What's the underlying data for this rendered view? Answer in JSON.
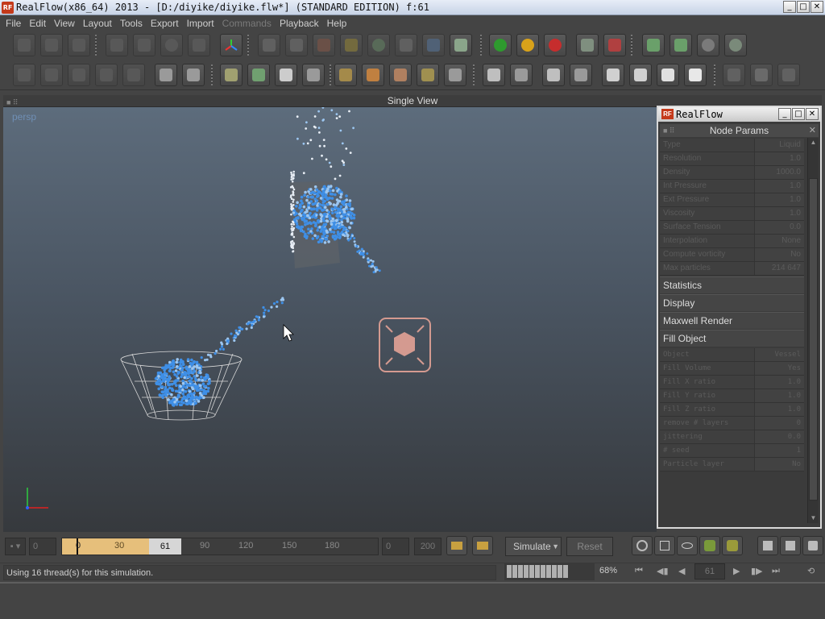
{
  "window": {
    "title": "RealFlow(x86_64) 2013 - [D:/diyike/diyike.flw*] (STANDARD EDITION) f:61",
    "app_icon": "RF",
    "minimize": "_",
    "maximize": "□",
    "close": "✕"
  },
  "menu": [
    "File",
    "Edit",
    "View",
    "Layout",
    "Tools",
    "Export",
    "Import",
    "Commands",
    "Playback",
    "Help"
  ],
  "viewport": {
    "header": "Single View",
    "camera": "persp"
  },
  "panel": {
    "window_title": "RealFlow",
    "header": "Node Params",
    "params": [
      {
        "label": "Type",
        "value": "Liquid"
      },
      {
        "label": "Resolution",
        "value": "1.0"
      },
      {
        "label": "Density",
        "value": "1000.0"
      },
      {
        "label": "Int Pressure",
        "value": "1.0"
      },
      {
        "label": "Ext Pressure",
        "value": "1.0"
      },
      {
        "label": "Viscosity",
        "value": "1.0"
      },
      {
        "label": "Surface Tension",
        "value": "0.0"
      },
      {
        "label": "Interpolation",
        "value": "None"
      },
      {
        "label": "Compute vorticity",
        "value": "No"
      },
      {
        "label": "Max particles",
        "value": "214 647"
      }
    ],
    "sections": [
      "Statistics",
      "Display",
      "Maxwell Render",
      "Fill Object"
    ],
    "fill_params": [
      {
        "label": "Object",
        "value": "Vessel"
      },
      {
        "label": "Fill Volume",
        "value": "Yes"
      },
      {
        "label": "Fill X ratio",
        "value": "1.0"
      },
      {
        "label": "Fill Y ratio",
        "value": "1.0"
      },
      {
        "label": "Fill Z ratio",
        "value": "1.0"
      },
      {
        "label": "remove # layers",
        "value": "0"
      },
      {
        "label": "jittering",
        "value": "0.0"
      },
      {
        "label": "# seed",
        "value": "1"
      },
      {
        "label": "Particle layer",
        "value": "No"
      }
    ]
  },
  "timeline": {
    "start": "0",
    "range_start": "0",
    "current_frame": "61",
    "ticks": [
      "0",
      "30",
      "90",
      "120",
      "150",
      "180"
    ],
    "min": "0",
    "max": "200",
    "simulate_label": "Simulate",
    "reset_label": "Reset"
  },
  "status": {
    "message": "Using 16 thread(s) for this simulation.",
    "progress_pct": "68%",
    "progress": 0.68,
    "frame": "61"
  },
  "colors": {
    "particles": "#3f8fe6",
    "particles_light": "#9cc6f0",
    "timeline_range": "#e6bf7b",
    "icon_accent": "#d49a90"
  }
}
